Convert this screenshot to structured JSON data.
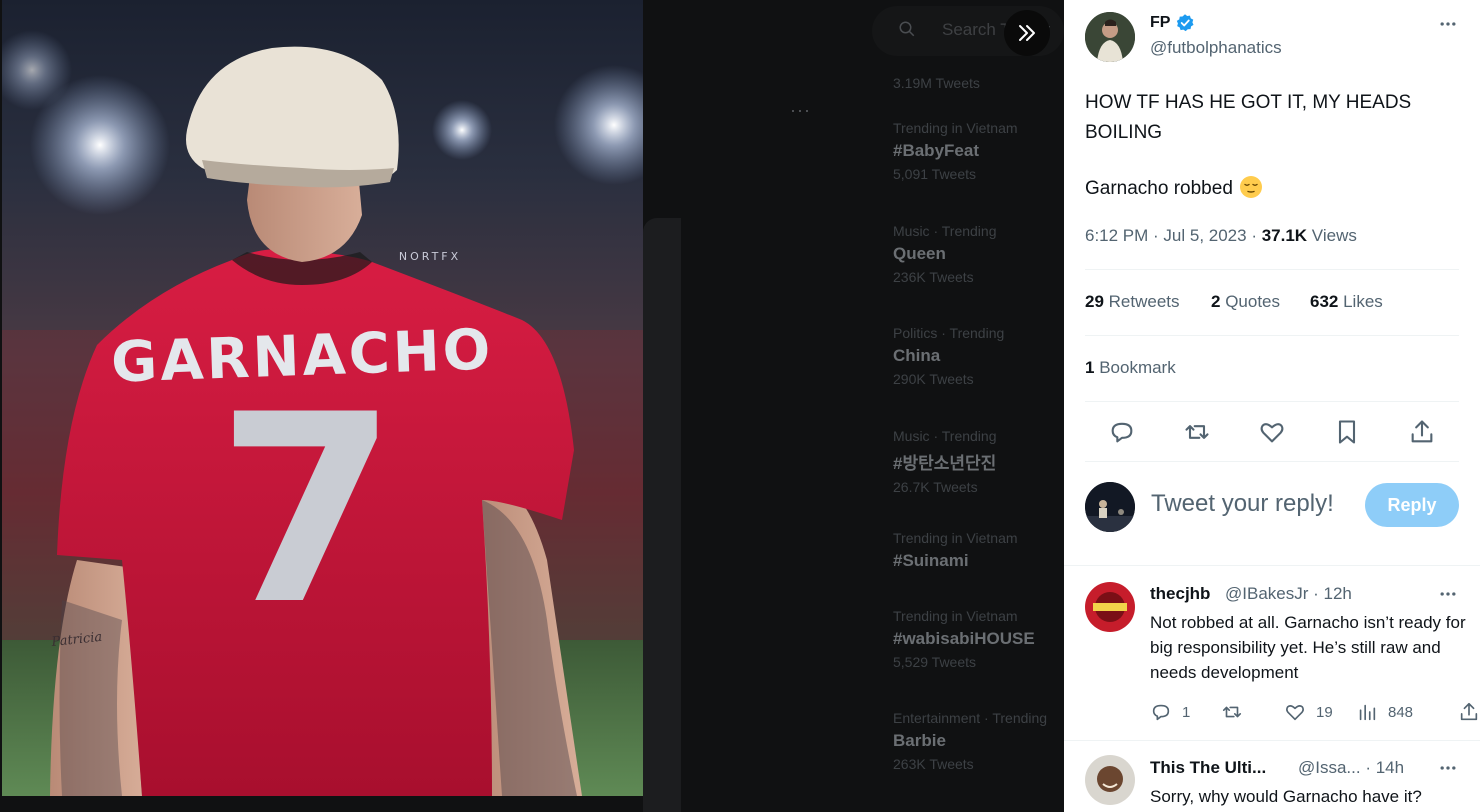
{
  "background": {
    "search_placeholder": "Search Twitter",
    "top_count": "3.19M Tweets",
    "trends": [
      {
        "category": "Trending in Vietnam",
        "name": "#BabyFeat",
        "count": "5,091 Tweets"
      },
      {
        "category": "Music · Trending",
        "name": "Queen",
        "count": "236K Tweets"
      },
      {
        "category": "Politics · Trending",
        "name": "China",
        "count": "290K Tweets"
      },
      {
        "category": "Music · Trending",
        "name": "#방탄소년단진",
        "count": "26.7K Tweets"
      },
      {
        "category": "Trending in Vietnam",
        "name": "#Suinami",
        "count": ""
      },
      {
        "category": "Trending in Vietnam",
        "name": "#wabisabiHOUSE",
        "count": "5,529 Tweets"
      },
      {
        "category": "Entertainment · Trending",
        "name": "Barbie",
        "count": "263K Tweets"
      }
    ]
  },
  "media": {
    "jersey_name": "GARNACHO",
    "jersey_number": "7",
    "watermark": "NORTFX",
    "tattoo_text": "Patricia"
  },
  "tweet": {
    "author_name": "FP",
    "author_handle": "@futbolphanatics",
    "text_line1": "HOW TF HAS HE GOT IT, MY HEADS BOILING",
    "text_line2": "Garnacho robbed",
    "time": "6:12 PM · Jul 5, 2023 · ",
    "views_count": "37.1K",
    "views_label": " Views",
    "retweets_count": "29",
    "retweets_label": " Retweets",
    "quotes_count": "2",
    "quotes_label": " Quotes",
    "likes_count": "632",
    "likes_label": " Likes",
    "bookmarks_count": "1",
    "bookmarks_label": " Bookmark"
  },
  "reply_box": {
    "placeholder": "Tweet your reply!",
    "button_label": "Reply"
  },
  "replies": [
    {
      "name": "thecjhb",
      "handle": "@IBakesJr · 12h",
      "text": "Not robbed at all. Garnacho isn’t ready for big responsibility yet. He’s still raw and needs development",
      "replies": "1",
      "retweets": "",
      "likes": "19",
      "views": "848"
    },
    {
      "name": "This The Ulti...",
      "handle": "@Issa... · 14h",
      "text": "Sorry, why would Garnacho have it?"
    }
  ],
  "colors": {
    "accent": "#1d9bf0",
    "reply_button": "#8ecdf8",
    "secondary_text": "#536471",
    "jersey": "#c8163a"
  }
}
